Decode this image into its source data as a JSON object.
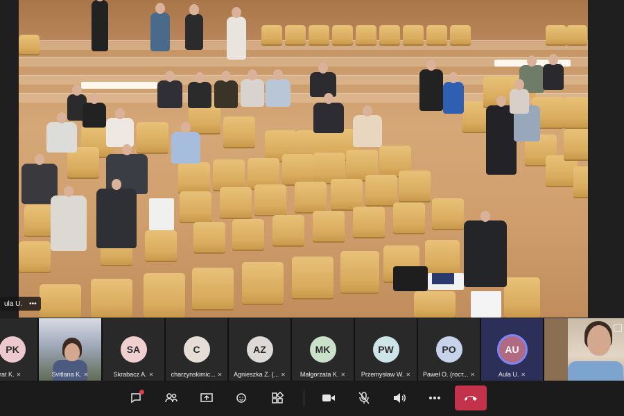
{
  "main_video": {
    "label_name": "ula U.",
    "label_more": "•••"
  },
  "participants": [
    {
      "initials": "PK",
      "name": "orat K.",
      "color": "#ecc9cf",
      "type": "avatar"
    },
    {
      "initials": "",
      "name": "Svitlana K.",
      "type": "video"
    },
    {
      "initials": "SA",
      "name": "Skrabacz A.",
      "color": "#f0cfd0",
      "type": "avatar"
    },
    {
      "initials": "C",
      "name": "charzynskimic...",
      "color": "#e6ded6",
      "type": "avatar"
    },
    {
      "initials": "AZ",
      "name": "Agnieszka Z. (...",
      "color": "#ddd9d6",
      "type": "avatar"
    },
    {
      "initials": "MK",
      "name": "Małgorzata K.",
      "color": "#c9e1c9",
      "type": "avatar"
    },
    {
      "initials": "PW",
      "name": "Przemysław W.",
      "color": "#cde4e8",
      "type": "avatar"
    },
    {
      "initials": "PO",
      "name": "Paweł O. (гост...",
      "color": "#c6d3ea",
      "type": "avatar"
    },
    {
      "initials": "AU",
      "name": "Aula U.",
      "color": "#b06a82",
      "type": "avatar",
      "active": true
    },
    {
      "initials": "",
      "name": "",
      "type": "video2"
    }
  ],
  "toolbar": {
    "chat_icon": "chat-icon",
    "people_icon": "people-icon",
    "share_icon": "share-icon",
    "react_icon": "react-icon",
    "apps_icon": "apps-icon",
    "camera_icon": "camera-icon",
    "mic_icon": "mic-off-icon",
    "speaker_icon": "speaker-icon",
    "more_icon": "more-icon",
    "leave_icon": "hangup-icon"
  },
  "colors": {
    "accent": "#7f85f5",
    "leave": "#c4314b"
  }
}
